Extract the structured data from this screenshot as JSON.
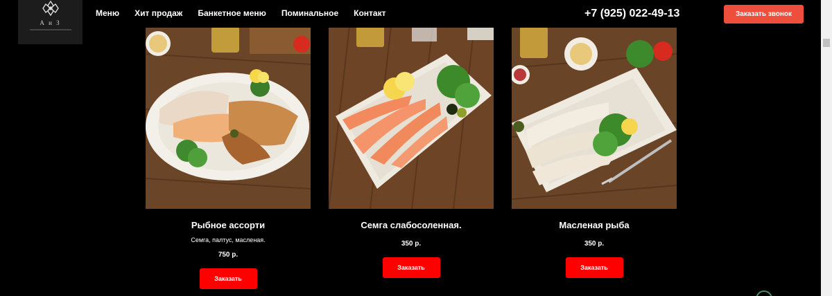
{
  "header": {
    "logo_text": "А и З",
    "nav": [
      "Меню",
      "Хит продаж",
      "Банкетное меню",
      "Поминальное",
      "Контакт"
    ],
    "phone": "+7 (925) 022-49-13",
    "callback_label": "Заказать звонок"
  },
  "products": [
    {
      "title": "Рыбное ассорти",
      "description": "Семга, палтус, масленая.",
      "price": "750 р.",
      "button": "Заказать"
    },
    {
      "title": "Семга слабосоленная.",
      "price": "350 р.",
      "button": "Заказать"
    },
    {
      "title": "Масленая рыба",
      "price": "350 р.",
      "button": "Заказать"
    }
  ],
  "colors": {
    "accent": "#ee4f3c",
    "order_button": "#ff0000",
    "background": "#000000"
  }
}
